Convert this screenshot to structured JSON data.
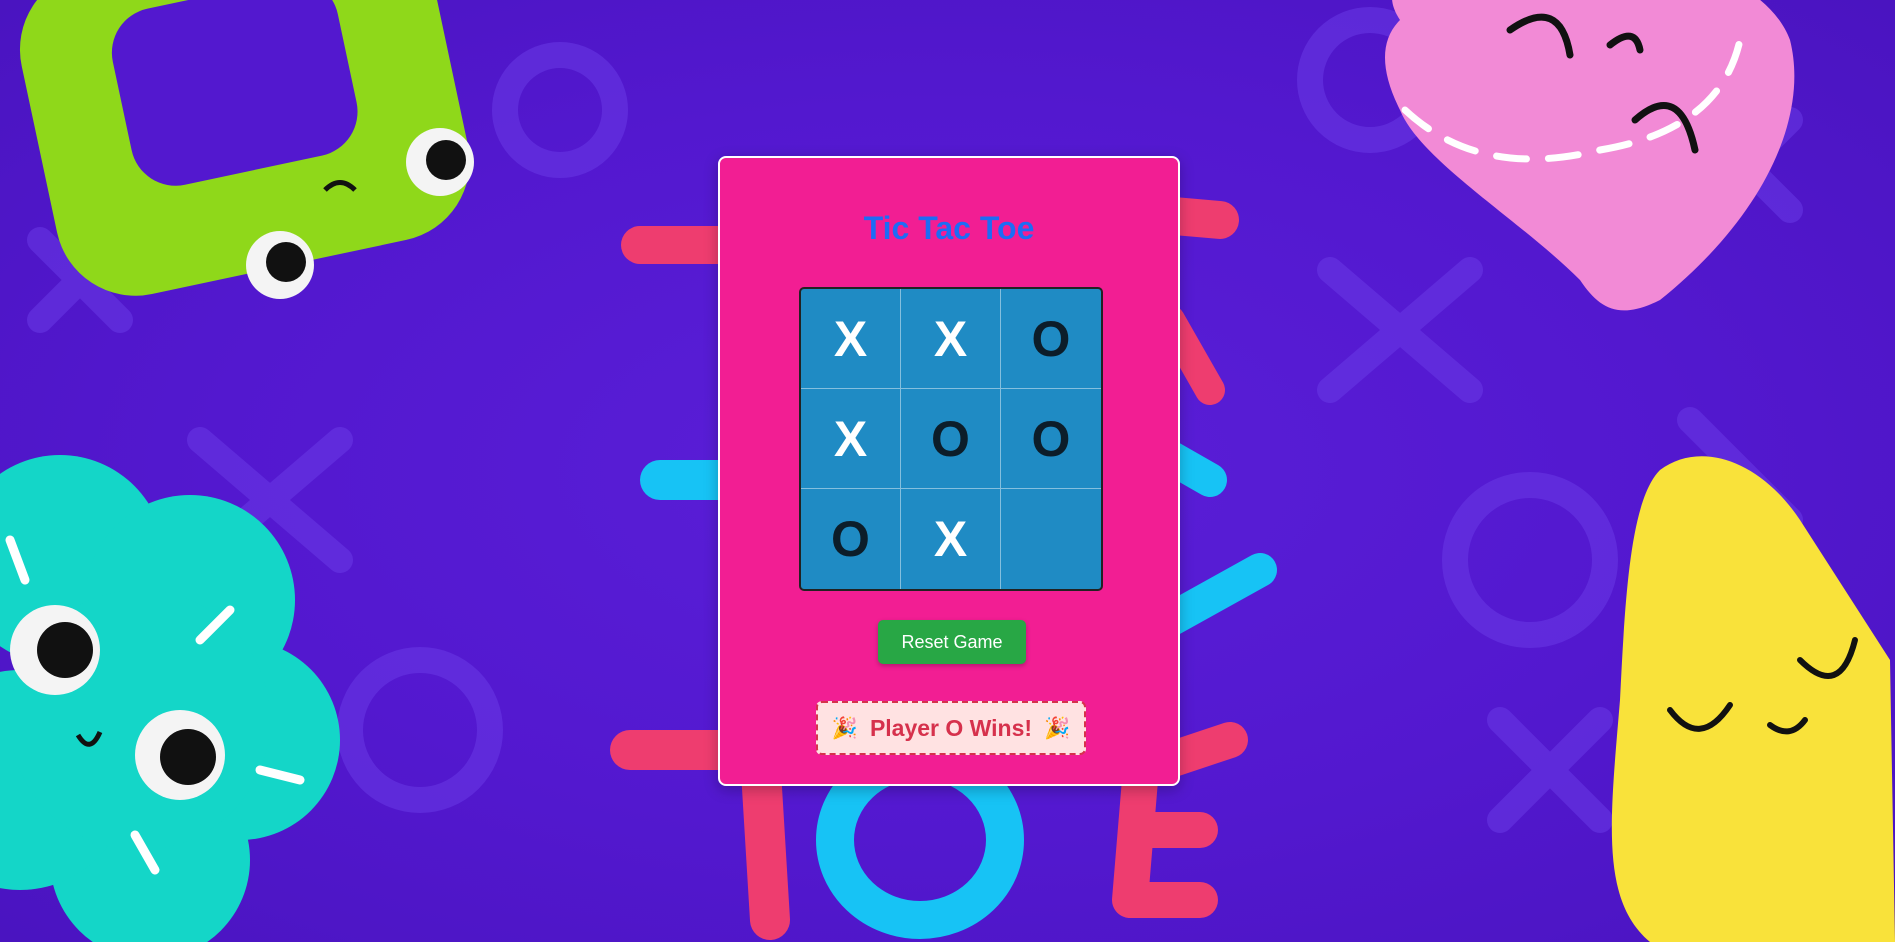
{
  "game": {
    "title": "Tic Tac Toe",
    "board": [
      {
        "mark": "X"
      },
      {
        "mark": "X"
      },
      {
        "mark": "O"
      },
      {
        "mark": "X"
      },
      {
        "mark": "O"
      },
      {
        "mark": "O"
      },
      {
        "mark": "O"
      },
      {
        "mark": "X"
      },
      {
        "mark": ""
      }
    ],
    "reset_label": "Reset Game",
    "status_text": "Player O Wins!",
    "status_icon": "party-popper-icon"
  },
  "colors": {
    "background": "#5318cf",
    "card": "#f21e93",
    "title": "#1d6cf5",
    "board": "#1f8bc4",
    "x_mark": "#ffffff",
    "o_mark": "#0c1d2a",
    "reset_button": "#28a745",
    "status_text": "#d6314c",
    "status_background": "#ffe2e2"
  }
}
